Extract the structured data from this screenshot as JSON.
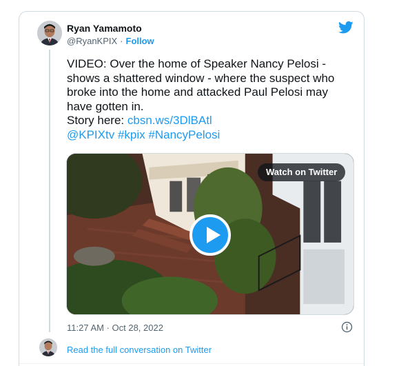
{
  "tweet": {
    "author": {
      "name": "Ryan Yamamoto",
      "handle": "@RyanKPIX",
      "separator": "·",
      "follow_label": "Follow"
    },
    "text_lines": [
      "VIDEO: Over the home of Speaker Nancy Pelosi -",
      "shows a shattered window - where the suspect who",
      "broke into the home and attacked Paul Pelosi may",
      "have gotten in."
    ],
    "story_prefix": "Story here:",
    "story_link": "cbsn.ws/3DlBAtl",
    "hashtags": {
      "mention": "@KPIXtv",
      "tag1": "#kpix",
      "tag2": "#NancyPelosi"
    },
    "media": {
      "watch_label": "Watch on Twitter",
      "play_icon": "play-icon"
    },
    "timestamp": "11:27 AM · Oct 28, 2022",
    "read_more": "Read the full conversation on Twitter"
  },
  "icons": {
    "brand": "twitter-bird-icon",
    "info": "info-icon"
  },
  "colors": {
    "link": "#1d9bf0",
    "secondary_text": "#536471",
    "border": "#cfd9de"
  }
}
